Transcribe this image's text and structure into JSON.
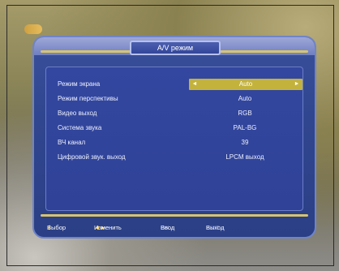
{
  "osd": {
    "title": "A/V режим",
    "settings": [
      {
        "label": "Режим экрана",
        "value": "Auto",
        "selected": true
      },
      {
        "label": "Режим перспективы",
        "value": "Auto"
      },
      {
        "label": "Видео выход",
        "value": "RGB"
      },
      {
        "label": "Система звука",
        "value": "PAL-BG"
      },
      {
        "label": "ВЧ канал",
        "value": "39"
      },
      {
        "label": "Цифровой звук. выход",
        "value": "LPCM выход"
      }
    ],
    "arrows": {
      "left": "◄",
      "right": "►"
    },
    "footer": {
      "select_key": "⇕",
      "select_label": "Выбор",
      "change_key": "◄►",
      "change_label": "Изменить",
      "ok_key": "OK",
      "ok_label": "Ввод",
      "exit_key": "EXIT",
      "exit_label": "Выход"
    },
    "colors": {
      "panel": "#30468f",
      "selection": "#c3b23c",
      "accent_line": "#d9c46a"
    }
  }
}
